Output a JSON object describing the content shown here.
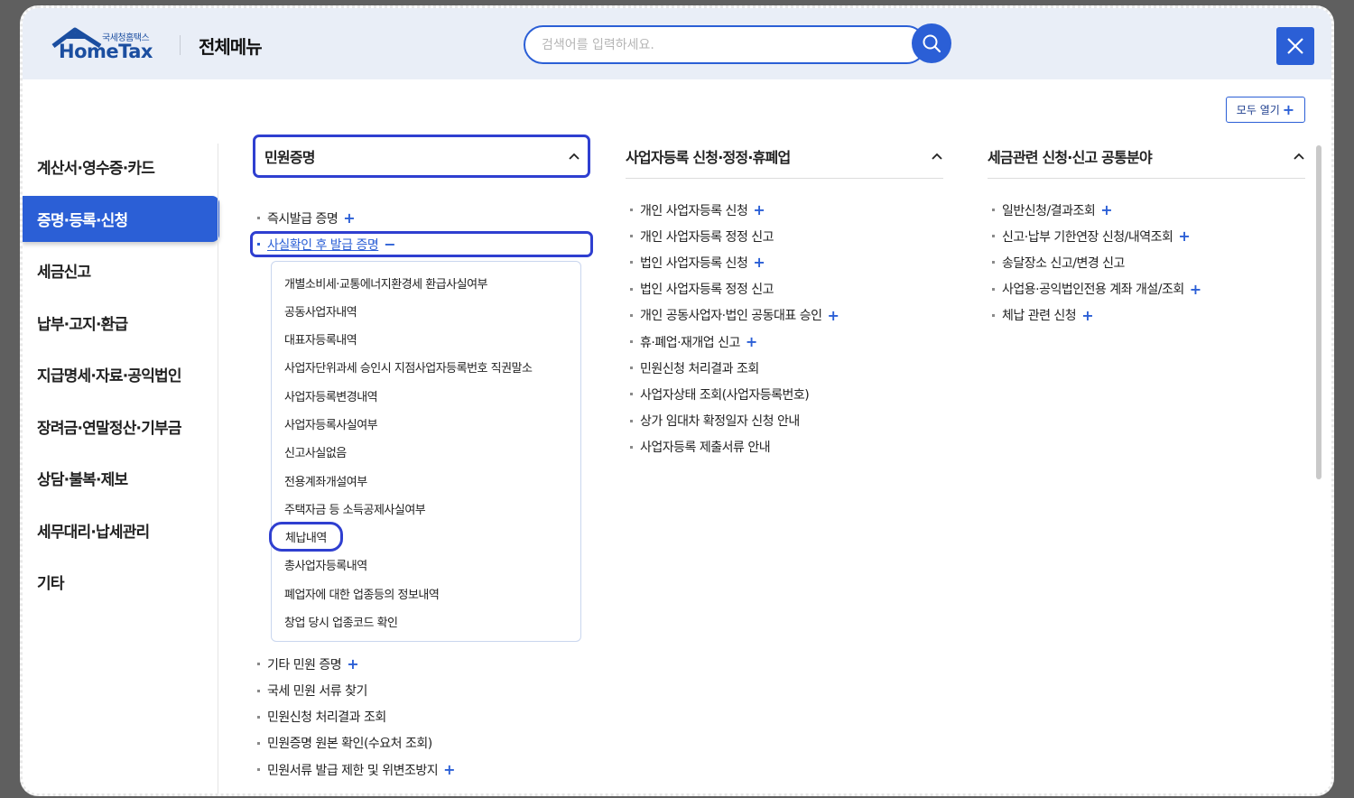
{
  "header": {
    "logo_small": "국세청홈택스",
    "logo_main": "HomeTax",
    "title": "전체메뉴",
    "search_placeholder": "검색어를 입력하세요.",
    "search_icon": "search-icon",
    "close_icon": "close-icon"
  },
  "expand_all": {
    "label": "모두 열기",
    "icon": "+"
  },
  "sidebar": {
    "items": [
      {
        "label": "계산서·영수증·카드",
        "active": false
      },
      {
        "label": "증명·등록·신청",
        "active": true
      },
      {
        "label": "세금신고",
        "active": false
      },
      {
        "label": "납부·고지·환급",
        "active": false
      },
      {
        "label": "지급명세·자료·공익법인",
        "active": false
      },
      {
        "label": "장려금·연말정산·기부금",
        "active": false
      },
      {
        "label": "상담·불복·제보",
        "active": false
      },
      {
        "label": "세무대리·납세관리",
        "active": false
      },
      {
        "label": "기타",
        "active": false
      }
    ]
  },
  "columns": [
    {
      "title": "민원증명",
      "items": [
        {
          "label": "즉시발급 증명",
          "toggle": "+"
        },
        {
          "label": "사실확인 후 발급 증명",
          "toggle": "−"
        },
        {
          "label": "기타 민원 증명",
          "toggle": "+"
        },
        {
          "label": "국세 민원 서류 찾기",
          "toggle": ""
        },
        {
          "label": "민원신청 처리결과 조회",
          "toggle": ""
        },
        {
          "label": "민원증명 원본 확인(수요처 조회)",
          "toggle": ""
        },
        {
          "label": "민원서류 발급 제한 및 위변조방지",
          "toggle": "+"
        }
      ],
      "subitems": [
        "개별소비세·교통에너지환경세 환급사실여부",
        "공동사업자내역",
        "대표자등록내역",
        "사업자단위과세 승인시 지점사업자등록번호 직권말소",
        "사업자등록변경내역",
        "사업자등록사실여부",
        "신고사실없음",
        "전용계좌개설여부",
        "주택자금 등 소득공제사실여부",
        "체납내역",
        "총사업자등록내역",
        "폐업자에 대한 업종등의 정보내역",
        "창업 당시 업종코드 확인"
      ]
    },
    {
      "title": "사업자등록 신청·정정·휴폐업",
      "items": [
        {
          "label": "개인 사업자등록 신청",
          "toggle": "+"
        },
        {
          "label": "개인 사업자등록 정정 신고",
          "toggle": ""
        },
        {
          "label": "법인 사업자등록 신청",
          "toggle": "+"
        },
        {
          "label": "법인 사업자등록 정정 신고",
          "toggle": ""
        },
        {
          "label": "개인 공동사업자·법인 공동대표 승인",
          "toggle": "+"
        },
        {
          "label": "휴·폐업·재개업 신고",
          "toggle": "+"
        },
        {
          "label": "민원신청 처리결과 조회",
          "toggle": ""
        },
        {
          "label": "사업자상태 조회(사업자등록번호)",
          "toggle": ""
        },
        {
          "label": "상가 임대차 확정일자 신청 안내",
          "toggle": ""
        },
        {
          "label": "사업자등록 제출서류 안내",
          "toggle": ""
        }
      ]
    },
    {
      "title": "세금관련 신청·신고 공통분야",
      "items": [
        {
          "label": "일반신청/결과조회",
          "toggle": "+"
        },
        {
          "label": "신고·납부 기한연장 신청/내역조회",
          "toggle": "+"
        },
        {
          "label": "송달장소 신고/변경 신고",
          "toggle": ""
        },
        {
          "label": "사업용·공익법인전용 계좌 개설/조회",
          "toggle": "+"
        },
        {
          "label": "체납 관련 신청",
          "toggle": "+"
        }
      ]
    }
  ],
  "colors": {
    "accent": "#2b5fd6",
    "highlight_border": "#2f3fd0",
    "header_bg": "#e9eef7"
  }
}
